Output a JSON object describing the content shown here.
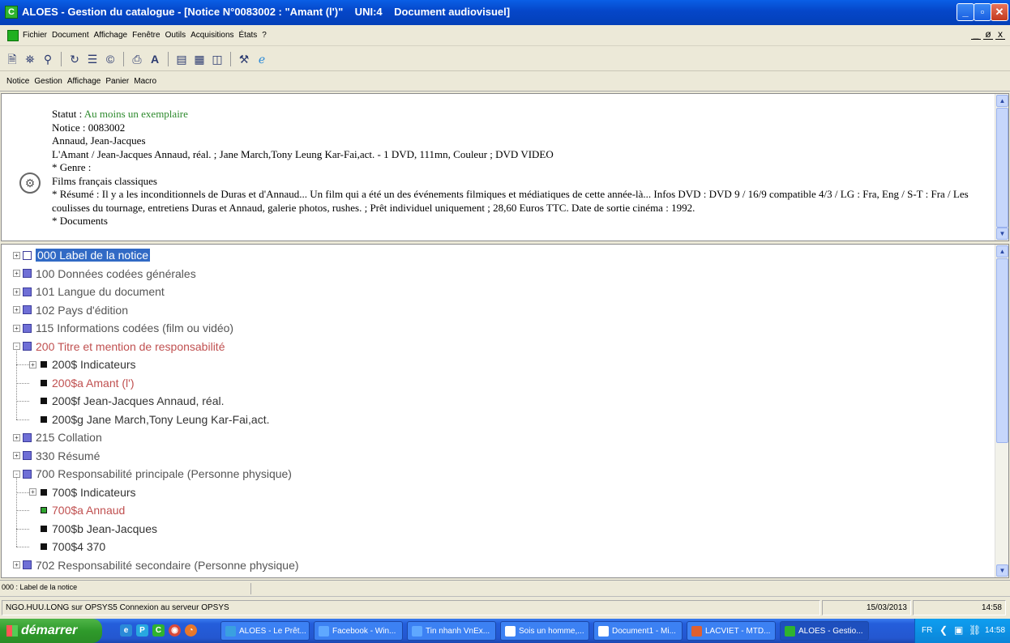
{
  "window": {
    "title": "ALOES - Gestion du catalogue - [Notice N°0083002 : \"Amant (l')\"    UNI:4    Document audiovisuel]",
    "app_icon": "C",
    "controls": [
      "minimize",
      "maximize",
      "close"
    ]
  },
  "menubar": {
    "items": [
      "Fichier",
      "Document",
      "Affichage",
      "Fenêtre",
      "Outils",
      "Acquisitions",
      "États",
      "?"
    ],
    "mdi_controls": [
      "_",
      "ø",
      "x"
    ]
  },
  "toolbar": {
    "icons": [
      "document-icon",
      "binoculars-icon",
      "binoculars-alt-icon",
      "refresh-icon",
      "list-icon",
      "copyright-icon",
      "print-icon",
      "font-icon",
      "layout-icon",
      "table-icon",
      "columns-icon",
      "tools-icon",
      "ie-icon"
    ]
  },
  "submenu": {
    "items": [
      "Notice",
      "Gestion",
      "Affichage",
      "Panier",
      "Macro"
    ]
  },
  "notice": {
    "statut_label": "Statut : ",
    "statut_value": "Au moins un exemplaire",
    "notice_line": "Notice : 0083002",
    "author": "Annaud, Jean-Jacques",
    "description": "L'Amant / Jean-Jacques Annaud, réal. ; Jane March,Tony Leung Kar-Fai,act. - 1 DVD, 111mn, Couleur ; DVD VIDEO",
    "genre_label": "* Genre :",
    "genre_value": "Films français classiques",
    "resume": "* Résumé : Il y a les inconditionnels de Duras et d'Annaud... Un film qui a été un des événements filmiques et médiatiques de cette année-là... Infos DVD : DVD 9 / 16/9 compatible 4/3 / LG : Fra, Eng / S-T : Fra / Les coulisses du tournage, entretiens Duras et Annaud, galerie photos, rushes. ; Prêt individuel uniquement ; 28,60 Euros TTC. Date de sortie cinéma : 1992.",
    "cut_line": "* Documents"
  },
  "tree": {
    "nodes": [
      {
        "label": "000 Label de la notice",
        "level": 0,
        "style": "selected",
        "toggle": "+"
      },
      {
        "label": "100 Données codées générales",
        "level": 0,
        "style": "normal",
        "toggle": "+"
      },
      {
        "label": "101 Langue du document",
        "level": 0,
        "style": "normal",
        "toggle": "+"
      },
      {
        "label": "102 Pays d'édition",
        "level": 0,
        "style": "normal",
        "toggle": "+"
      },
      {
        "label": "115 Informations codées (film ou vidéo)",
        "level": 0,
        "style": "normal",
        "toggle": "+"
      },
      {
        "label": "200 Titre et mention de responsabilité",
        "level": 0,
        "style": "red",
        "toggle": "-"
      },
      {
        "label": "200$ Indicateurs",
        "level": 1,
        "style": "dark",
        "toggle": "+"
      },
      {
        "label": "200$a Amant (l')",
        "level": 1,
        "style": "red",
        "toggle": ""
      },
      {
        "label": "200$f Jean-Jacques Annaud, réal.",
        "level": 1,
        "style": "dark",
        "toggle": ""
      },
      {
        "label": "200$g Jane March,Tony Leung Kar-Fai,act.",
        "level": 1,
        "style": "dark",
        "toggle": ""
      },
      {
        "label": "215 Collation",
        "level": 0,
        "style": "normal",
        "toggle": "+"
      },
      {
        "label": "330 Résumé",
        "level": 0,
        "style": "normal",
        "toggle": "+"
      },
      {
        "label": "700 Responsabilité principale (Personne physique)",
        "level": 0,
        "style": "normal",
        "toggle": "-"
      },
      {
        "label": "700$ Indicateurs",
        "level": 1,
        "style": "dark",
        "toggle": "+"
      },
      {
        "label": "700$a Annaud",
        "level": 1,
        "style": "red",
        "toggle": "",
        "marker": "green"
      },
      {
        "label": "700$b Jean-Jacques",
        "level": 1,
        "style": "dark",
        "toggle": ""
      },
      {
        "label": "700$4 370",
        "level": 1,
        "style": "dark",
        "toggle": ""
      },
      {
        "label": "702 Responsabilité secondaire (Personne physique)",
        "level": 0,
        "style": "normal",
        "toggle": "+"
      }
    ]
  },
  "status": {
    "field": "000 : Label de la notice",
    "connection": "NGO.HUU.LONG sur OPSYS5 Connexion au serveur OPSYS",
    "date": "15/03/2013",
    "time": "14:58"
  },
  "taskbar": {
    "start_label": "démarrer",
    "quicklaunch": [
      "ie-icon",
      "p-icon",
      "c-icon",
      "chrome-icon",
      "firefox-icon"
    ],
    "tasks": [
      {
        "label": "ALOES - Le Prêt...",
        "icon_color": "#3aa0e0"
      },
      {
        "label": "Facebook - Win...",
        "icon_color": "#5fa8ff"
      },
      {
        "label": "Tin nhanh VnEx...",
        "icon_color": "#5fa8ff"
      },
      {
        "label": "Sois un homme,...",
        "icon_color": "#ffffff"
      },
      {
        "label": "Document1 - Mi...",
        "icon_color": "#ffffff"
      },
      {
        "label": "LACVIET - MTD...",
        "icon_color": "#e06030"
      },
      {
        "label": "ALOES - Gestio...",
        "icon_color": "#2fb32f",
        "active": true
      }
    ],
    "tray": {
      "lang": "FR",
      "time": "14:58"
    }
  }
}
